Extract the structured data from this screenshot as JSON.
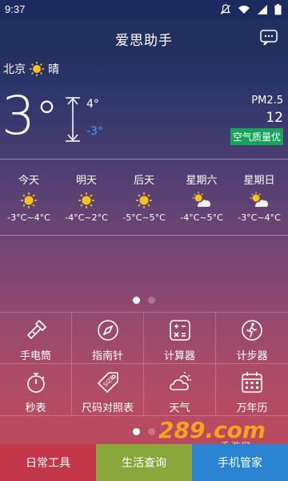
{
  "status_bar": {
    "time": "9:37",
    "icons": [
      "bell-off-icon",
      "wifi-icon",
      "signal-icon",
      "battery-icon"
    ]
  },
  "header": {
    "title": "爱思助手",
    "message_icon": "chat-icon"
  },
  "weather": {
    "city": "北京",
    "condition": "晴",
    "current_temp": "3",
    "degree_symbol": "°",
    "high": "4°",
    "low": "-3°",
    "aqi_label": "PM2.5",
    "aqi_value": "12",
    "aqi_quality": "空气质量优",
    "colors": {
      "low_temp": "#3ea6ff",
      "aqi_badge": "#18a35a"
    }
  },
  "forecast": [
    {
      "name": "今天",
      "icon": "sun-icon",
      "temps": "-3°C~4°C"
    },
    {
      "name": "明天",
      "icon": "sun-icon",
      "temps": "-4°C~2°C"
    },
    {
      "name": "后天",
      "icon": "sun-icon",
      "temps": "-5°C~5°C"
    },
    {
      "name": "星期六",
      "icon": "sun-cloud-icon",
      "temps": "-4°C~5°C"
    },
    {
      "name": "星期日",
      "icon": "sun-cloud-icon",
      "temps": "-3°C~4°C"
    }
  ],
  "tools": [
    {
      "label": "手电筒",
      "icon": "flashlight-icon"
    },
    {
      "label": "指南针",
      "icon": "compass-icon"
    },
    {
      "label": "计算器",
      "icon": "calculator-icon"
    },
    {
      "label": "计步器",
      "icon": "pedometer-icon"
    },
    {
      "label": "秒表",
      "icon": "stopwatch-icon"
    },
    {
      "label": "尺码对照表",
      "icon": "size-tag-icon"
    },
    {
      "label": "天气",
      "icon": "weather-icon"
    },
    {
      "label": "万年历",
      "icon": "calendar-icon"
    }
  ],
  "watermark": {
    "text": "289.com",
    "subtext": "手游网"
  },
  "tabs": [
    {
      "label": "日常工具",
      "color": "#c4374a"
    },
    {
      "label": "生活查询",
      "color": "#8aa63a"
    },
    {
      "label": "手机管家",
      "color": "#2b84cf"
    }
  ]
}
